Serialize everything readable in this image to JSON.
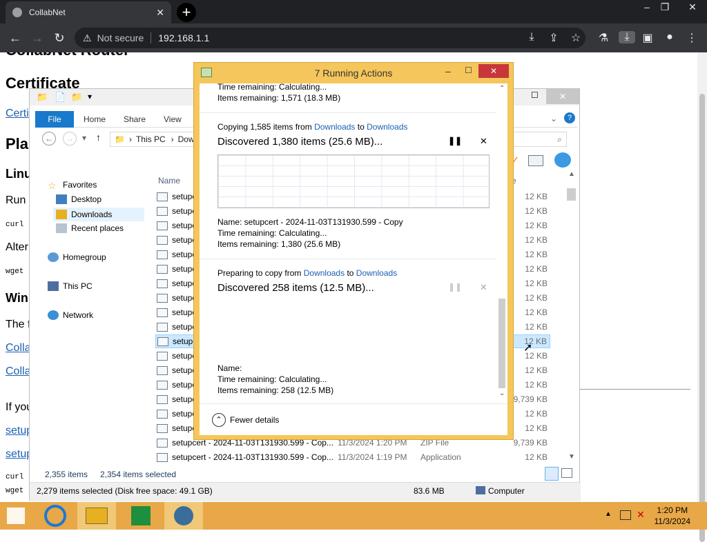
{
  "browser": {
    "tab_title": "CollabNet",
    "new_tab": "+",
    "not_secure": "Not secure",
    "url": "192.168.1.1"
  },
  "page": {
    "h_partial": "CollabNet Router",
    "certificate": "Certificate",
    "link1": "Certi",
    "pla": "Pla",
    "linu": "Linu",
    "run": "Run",
    "curl": "curl",
    "alter": "Alter",
    "wget": "wget",
    "win": "Win",
    "the": "The f",
    "colla1": "Colla",
    "colla2": "Colla",
    "ifyou": "If you",
    "setup1": "setup",
    "setup2": "setup",
    "curl2": "curl",
    "wget2": "wget"
  },
  "explorer": {
    "file_tab": "File",
    "tabs": [
      "Home",
      "Share",
      "View"
    ],
    "crumb_pc": "This PC",
    "crumb_dl": "Dow",
    "tree": [
      "Favorites",
      "Desktop",
      "Downloads",
      "Recent places",
      "Homegroup",
      "This PC",
      "Network"
    ],
    "col_name": "Name",
    "col_size": "e",
    "rows": [
      {
        "name": "setupc",
        "size": "12 KB"
      },
      {
        "name": "setupc",
        "size": "12 KB"
      },
      {
        "name": "setupc",
        "size": "12 KB"
      },
      {
        "name": "setupc",
        "size": "12 KB"
      },
      {
        "name": "setupc",
        "size": "12 KB"
      },
      {
        "name": "setupc",
        "size": "12 KB"
      },
      {
        "name": "setupc",
        "size": "12 KB"
      },
      {
        "name": "setupc",
        "size": "12 KB"
      },
      {
        "name": "setupc",
        "size": "12 KB"
      },
      {
        "name": "setupc",
        "size": "12 KB"
      },
      {
        "name": "setupc",
        "size": "12 KB"
      },
      {
        "name": "setupc",
        "size": "12 KB"
      },
      {
        "name": "setupc",
        "size": "12 KB"
      },
      {
        "name": "setupc",
        "size": "12 KB"
      },
      {
        "name": "setupc",
        "size": "9,739 KB"
      },
      {
        "name": "setupc",
        "size": "12 KB"
      },
      {
        "name": "setupc",
        "size": "12 KB"
      }
    ],
    "full_rows": [
      {
        "name": "setupcert - 2024-11-03T131930.599 - Cop...",
        "date": "11/3/2024 1:20 PM",
        "type": "ZIP File",
        "size": "9,739 KB"
      },
      {
        "name": "setupcert - 2024-11-03T131930.599 - Cop...",
        "date": "11/3/2024 1:19 PM",
        "type": "Application",
        "size": "12 KB"
      }
    ],
    "status_items": "2,355 items",
    "status_selected": "2,354 items selected",
    "bottom_left": "2,279 items selected (Disk free space: 49.1 GB)",
    "bottom_size": "83.6 MB",
    "bottom_computer": "Computer"
  },
  "dialog": {
    "title": "7 Running Actions",
    "top_time": "Time remaining:  Calculating...",
    "top_items": "Items remaining:  1,571 (18.3 MB)",
    "op1": {
      "copying": "Copying 1,585 items from ",
      "from": "Downloads",
      "to_word": " to ",
      "to": "Downloads",
      "status": "Discovered 1,380 items (25.6 MB)...",
      "name": "Name:  setupcert - 2024-11-03T131930.599 - Copy",
      "time": "Time remaining:  Calculating...",
      "items": "Items remaining:  1,380 (25.6 MB)"
    },
    "op2": {
      "preparing": "Preparing to copy from ",
      "from": "Downloads",
      "to_word": " to ",
      "to": "Downloads",
      "status": "Discovered 258 items (12.5 MB)...",
      "name": "Name:",
      "time": "Time remaining:  Calculating...",
      "items": "Items remaining:  258 (12.5 MB)"
    },
    "fewer": "Fewer details"
  },
  "taskbar": {
    "time": "1:20 PM",
    "date": "11/3/2024"
  }
}
